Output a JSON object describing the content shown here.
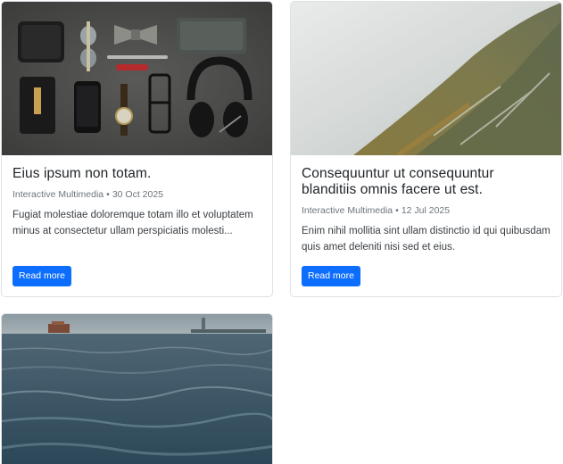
{
  "cards": [
    {
      "image_alt": "Flat lay of accessories: wallet, sunglasses, bow tie, notebook, phone, watch, glasses, headphones",
      "title": "Eius ipsum non totam.",
      "category": "Interactive Multimedia",
      "separator": "•",
      "date": "30 Oct 2025",
      "excerpt": "Fugiat molestiae doloremque totam illo et voluptatem minus at consectetur ullam perspiciatis molesti...",
      "button_label": "Read more"
    },
    {
      "image_alt": "Misty forested mountain slope",
      "title": "Consequuntur ut consequuntur blanditiis omnis facere ut est.",
      "category": "Interactive Multimedia",
      "separator": "•",
      "date": "12 Jul 2025",
      "excerpt": "Enim nihil mollitia sint ullam distinctio id qui quibusdam quis amet deleniti nisi sed et eius.",
      "button_label": "Read more"
    },
    {
      "image_alt": "Choppy sea with a ferry and distant statue on the horizon"
    }
  ],
  "colors": {
    "primary": "#0d6efd",
    "muted": "#6c757d",
    "border": "#dee2e6"
  }
}
